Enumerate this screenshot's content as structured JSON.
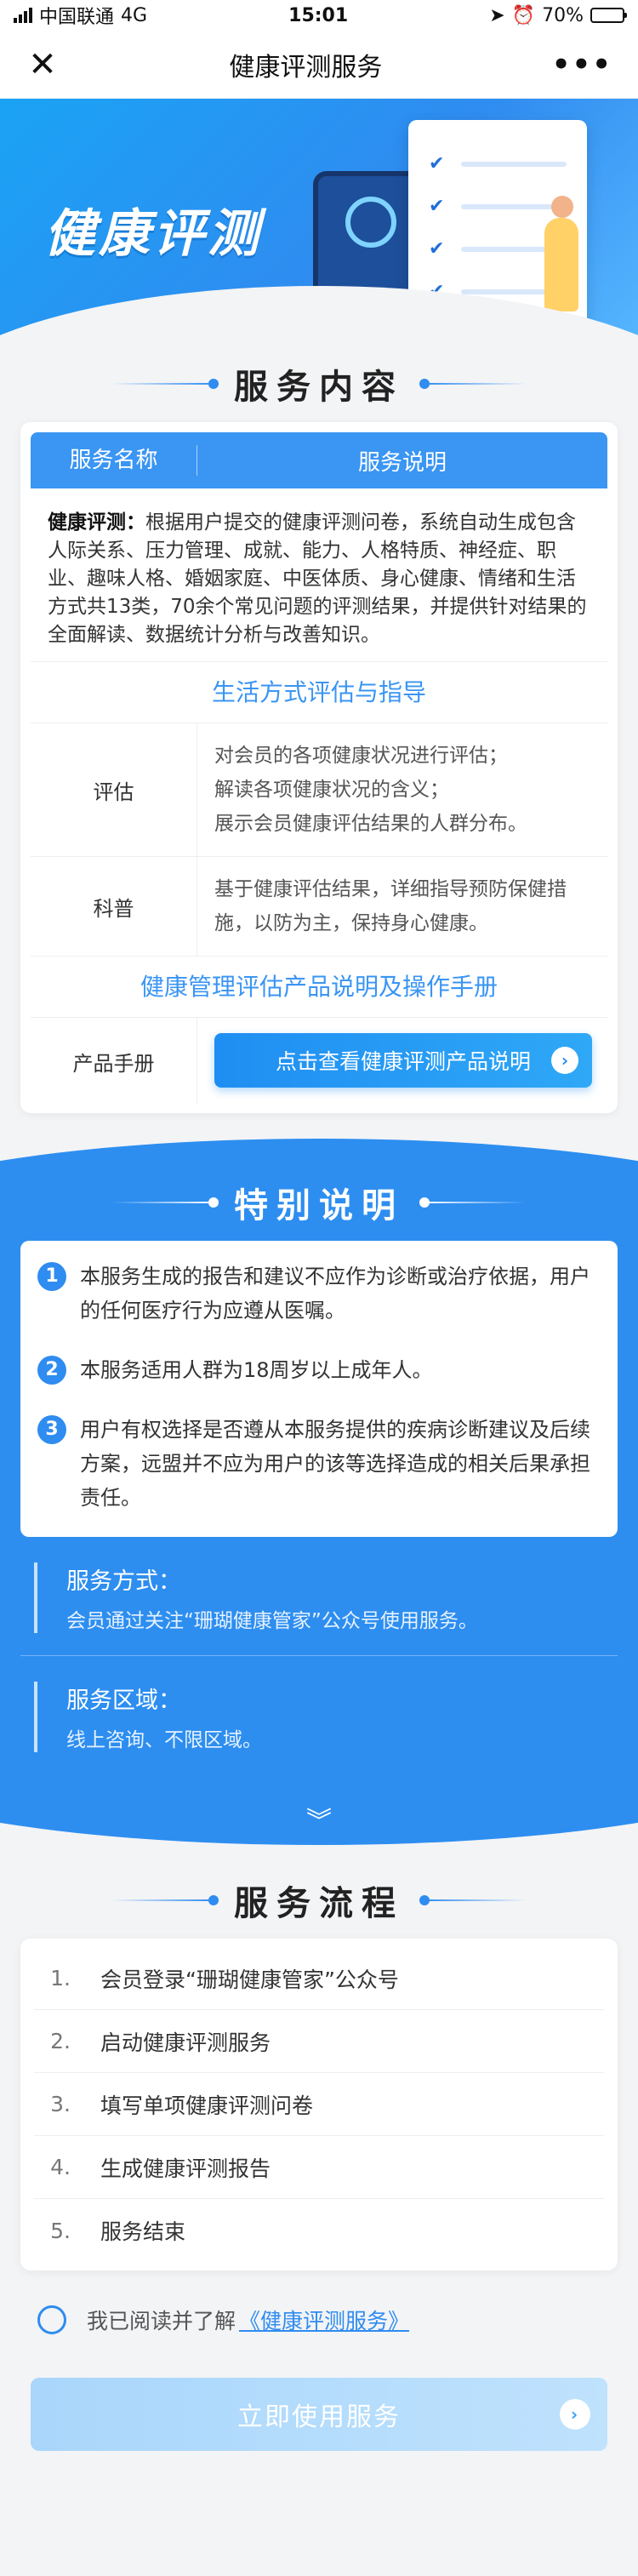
{
  "status_bar": {
    "carrier": "中国联通",
    "network": "4G",
    "time": "15:01",
    "battery": "70%",
    "battery_level": 0.7
  },
  "nav": {
    "title": "健康评测服务",
    "close_icon": "close-icon",
    "more_icon": "more-icon"
  },
  "banner": {
    "title": "健康评测"
  },
  "service_content": {
    "heading": "服务内容",
    "col_name": "服务名称",
    "col_desc": "服务说明",
    "intro_label": "健康评测：",
    "intro_text": "根据用户提交的健康评测问卷，系统自动生成包含人际关系、压力管理、成就、能力、人格特质、神经症、职业、趣味人格、婚姻家庭、中医体质、身心健康、情绪和生活方式共13类，70余个常见问题的评测结果，并提供针对结果的全面解读、数据统计分析与改善知识。",
    "subheading_1": "生活方式评估与指导",
    "rows": [
      {
        "name": "评估",
        "lines": [
          "对会员的各项健康状况进行评估；",
          "解读各项健康状况的含义；",
          "展示会员健康评估结果的人群分布。"
        ]
      },
      {
        "name": "科普",
        "lines": [
          "基于健康评估结果，详细指导预防保健措施，以防为主，保持身心健康。"
        ]
      }
    ],
    "subheading_2": "健康管理评估产品说明及操作手册",
    "manual_label": "产品手册",
    "manual_button": "点击查看健康评测产品说明"
  },
  "special": {
    "heading": "特别说明",
    "notes": [
      {
        "num": "1",
        "text": "本服务生成的报告和建议不应作为诊断或治疗依据，用户的任何医疗行为应遵从医嘱。"
      },
      {
        "num": "2",
        "text": "本服务适用人群为18周岁以上成年人。"
      },
      {
        "num": "3",
        "text": "用户有权选择是否遵从本服务提供的疾病诊断建议及后续方案，远盟并不应为用户的该等选择造成的相关后果承担责任。"
      }
    ],
    "method_label": "服务方式：",
    "method_text": "会员通过关注“珊瑚健康管家”公众号使用服务。",
    "area_label": "服务区域：",
    "area_text": "线上咨询、不限区域。"
  },
  "process": {
    "heading": "服务流程",
    "steps": [
      {
        "idx": "1.",
        "text": "会员登录“珊瑚健康管家”公众号"
      },
      {
        "idx": "2.",
        "text": "启动健康评测服务"
      },
      {
        "idx": "3.",
        "text": "填写单项健康评测问卷"
      },
      {
        "idx": "4.",
        "text": "生成健康评测报告"
      },
      {
        "idx": "5.",
        "text": "服务结束"
      }
    ]
  },
  "agreement": {
    "prefix": "我已阅读并了解",
    "link": "《健康评测服务》"
  },
  "cta": {
    "label": "立即使用服务"
  },
  "colors": {
    "primary": "#2f8cf0",
    "cta_disabled": "#a9d6fb"
  }
}
